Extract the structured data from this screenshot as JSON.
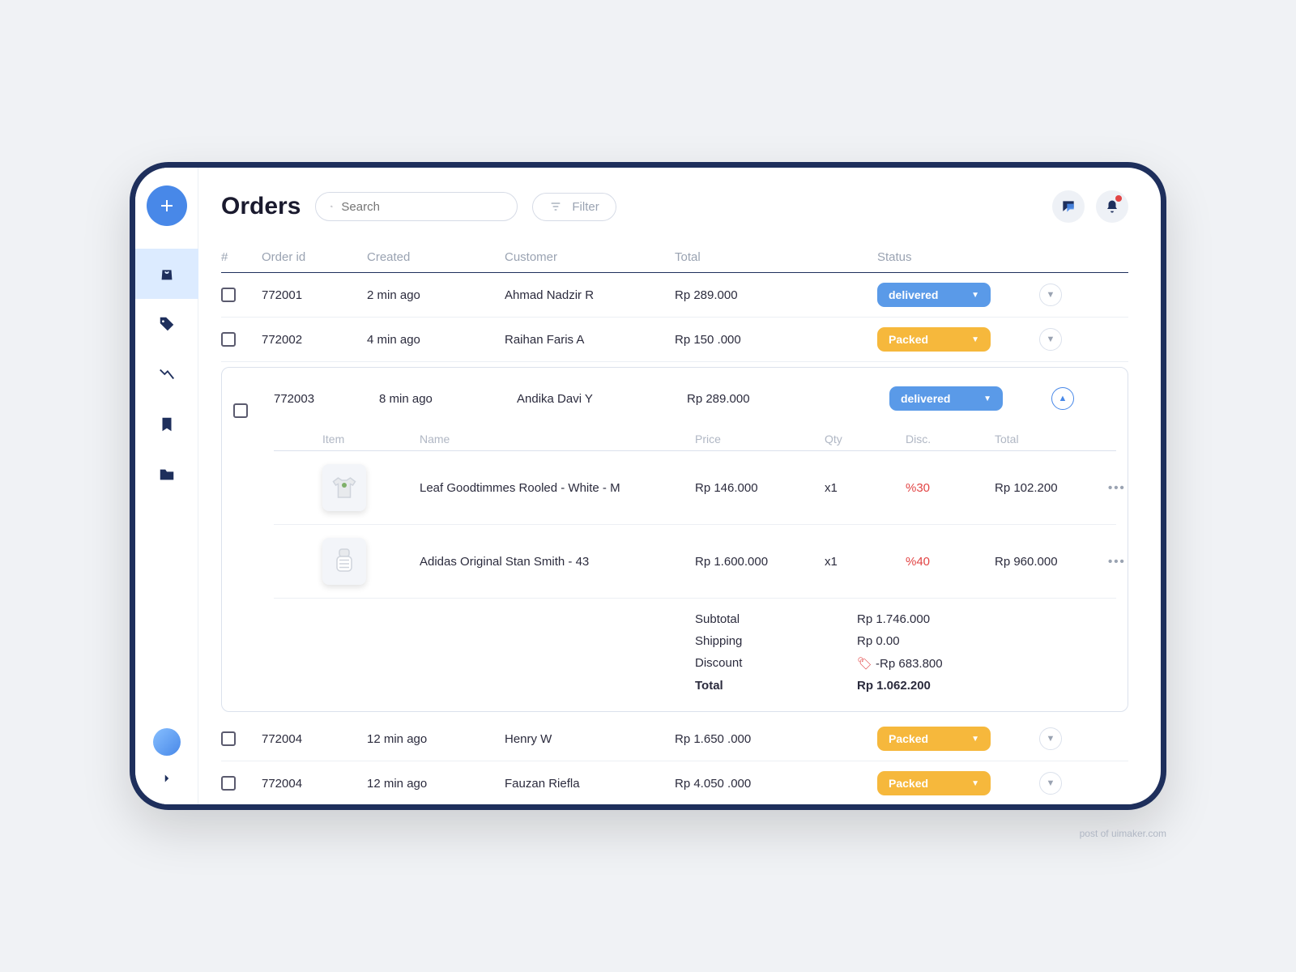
{
  "page": {
    "title": "Orders"
  },
  "search": {
    "placeholder": "Search"
  },
  "filter": {
    "label": "Filter"
  },
  "columns": {
    "checkbox": "#",
    "order_id": "Order id",
    "created": "Created",
    "customer": "Customer",
    "total": "Total",
    "status": "Status"
  },
  "orders": [
    {
      "id": "772001",
      "created": "2 min ago",
      "customer": "Ahmad Nadzir R",
      "total": "Rp 289.000",
      "status": "delivered",
      "status_type": "delivered"
    },
    {
      "id": "772002",
      "created": "4 min ago",
      "customer": "Raihan Faris A",
      "total": "Rp 150 .000",
      "status": "Packed",
      "status_type": "packed"
    },
    {
      "id": "772003",
      "created": "8 min ago",
      "customer": "Andika Davi Y",
      "total": "Rp 289.000",
      "status": "delivered",
      "status_type": "delivered",
      "expanded": true
    },
    {
      "id": "772004",
      "created": "12 min ago",
      "customer": "Henry W",
      "total": "Rp 1.650 .000",
      "status": "Packed",
      "status_type": "packed"
    },
    {
      "id": "772004",
      "created": "12 min ago",
      "customer": "Fauzan Riefla",
      "total": "Rp 4.050 .000",
      "status": "Packed",
      "status_type": "packed"
    }
  ],
  "detail_columns": {
    "item": "Item",
    "name": "Name",
    "price": "Price",
    "qty": "Qty",
    "disc": "Disc.",
    "total": "Total"
  },
  "order_items": [
    {
      "name": "Leaf Goodtimmes Rooled - White - M",
      "price": "Rp 146.000",
      "qty": "x1",
      "disc": "%30",
      "total": "Rp 102.200",
      "thumb": "tshirt"
    },
    {
      "name": "Adidas Original Stan Smith - 43",
      "price": "Rp 1.600.000",
      "qty": "x1",
      "disc": "%40",
      "total": "Rp 960.000",
      "thumb": "shoe"
    }
  ],
  "summary": {
    "subtotal_label": "Subtotal",
    "subtotal_value": "Rp 1.746.000",
    "shipping_label": "Shipping",
    "shipping_value": "Rp 0.00",
    "discount_label": "Discount",
    "discount_value": "-Rp 683.800",
    "total_label": "Total",
    "total_value": "Rp 1.062.200"
  },
  "watermark": "post of uimaker.com"
}
